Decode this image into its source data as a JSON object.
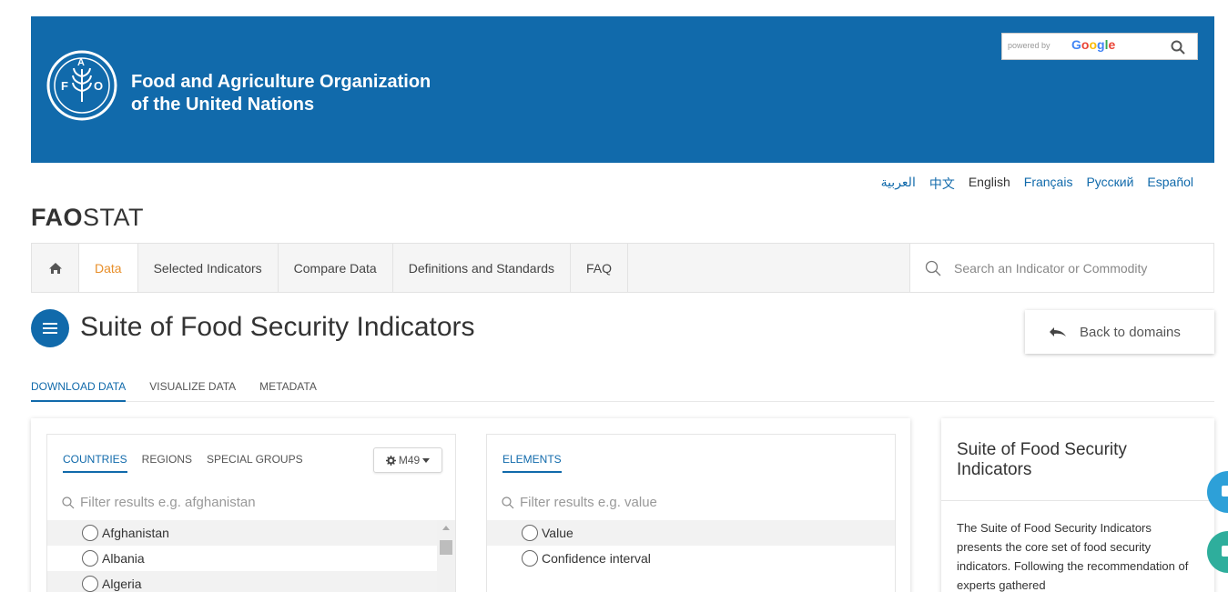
{
  "header": {
    "org_line1": "Food and Agriculture Organization",
    "org_line2": "of the United Nations",
    "logo_letters": [
      "F",
      "A",
      "O"
    ],
    "google_search": {
      "powered": "powered by",
      "brand": "Google"
    }
  },
  "languages": [
    {
      "label": "العربية",
      "current": false
    },
    {
      "label": "中文",
      "current": false
    },
    {
      "label": "English",
      "current": true
    },
    {
      "label": "Français",
      "current": false
    },
    {
      "label": "Русский",
      "current": false
    },
    {
      "label": "Español",
      "current": false
    }
  ],
  "brand": {
    "bold": "FAO",
    "rest": "STAT"
  },
  "nav": {
    "items": [
      "Data",
      "Selected Indicators",
      "Compare Data",
      "Definitions and Standards",
      "FAQ"
    ],
    "active": "Data",
    "search_placeholder": "Search an Indicator or Commodity"
  },
  "page": {
    "title": "Suite of Food Security Indicators",
    "back_label": "Back to domains"
  },
  "tabs": {
    "items": [
      "DOWNLOAD DATA",
      "VISUALIZE DATA",
      "METADATA"
    ],
    "active": "DOWNLOAD DATA"
  },
  "countries_panel": {
    "tabs": [
      "COUNTRIES",
      "REGIONS",
      "SPECIAL GROUPS"
    ],
    "active": "COUNTRIES",
    "selector": "M49",
    "filter_placeholder": "Filter results  e.g. afghanistan",
    "items": [
      "Afghanistan",
      "Albania",
      "Algeria"
    ]
  },
  "elements_panel": {
    "tab": "ELEMENTS",
    "filter_placeholder": "Filter results  e.g. value",
    "items": [
      "Value",
      "Confidence interval"
    ]
  },
  "side": {
    "title": "Suite of Food Security Indicators",
    "text": "The Suite of Food Security Indicators presents the core set of food security indicators. Following the recommendation of experts gathered"
  },
  "colors": {
    "brand_blue": "#116aab",
    "active_nav": "#e88f2a"
  }
}
